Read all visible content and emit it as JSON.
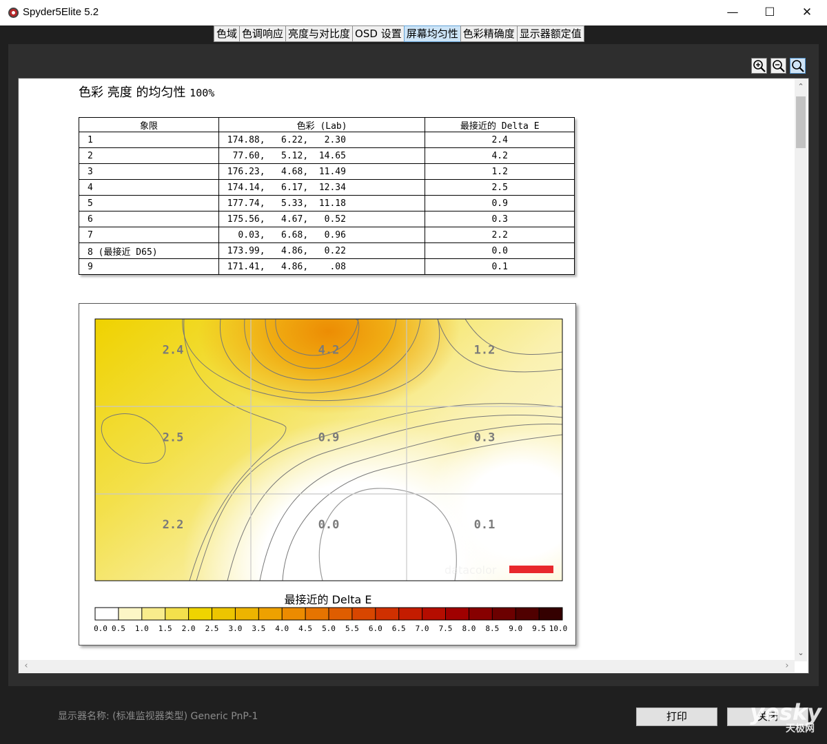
{
  "window": {
    "title": "Spyder5Elite 5.2",
    "minimize": "—",
    "maximize": "☐",
    "close": "✕"
  },
  "tabs": [
    {
      "label": "色域",
      "active": false
    },
    {
      "label": "色调响应",
      "active": false
    },
    {
      "label": "亮度与对比度",
      "active": false
    },
    {
      "label": "OSD 设置",
      "active": false
    },
    {
      "label": "屏幕均匀性",
      "active": true
    },
    {
      "label": "色彩精确度",
      "active": false
    },
    {
      "label": "显示器额定值",
      "active": false
    }
  ],
  "zoom_tools": [
    "zoom-in-icon",
    "zoom-out-icon",
    "zoom-fit-icon"
  ],
  "report": {
    "title": "色彩 亮度 的均匀性 ",
    "title_pct": "100%",
    "table": {
      "headers": [
        "象限",
        "色彩 (Lab)",
        "最接近的 Delta E"
      ],
      "rows": [
        {
          "q": "1",
          "lab": "174.88,   6.22,   2.30",
          "de": "2.4"
        },
        {
          "q": "2",
          "lab": " 77.60,   5.12,  14.65",
          "de": "4.2"
        },
        {
          "q": "3",
          "lab": "176.23,   4.68,  11.49",
          "de": "1.2"
        },
        {
          "q": "4",
          "lab": "174.14,   6.17,  12.34",
          "de": "2.5"
        },
        {
          "q": "5",
          "lab": "177.74,   5.33,  11.18",
          "de": "0.9"
        },
        {
          "q": "6",
          "lab": "175.56,   4.67,   0.52",
          "de": "0.3"
        },
        {
          "q": "7",
          "lab": "  0.03,   6.68,   0.96",
          "de": "2.2"
        },
        {
          "q": "8 (最接近 D65)",
          "lab": "173.99,   4.86,   0.22",
          "de": "0.0"
        },
        {
          "q": "9",
          "lab": "171.41,   4.86,    .08",
          "de": "0.1"
        }
      ]
    }
  },
  "chart_data": {
    "type": "heatmap",
    "grid": {
      "rows": 3,
      "cols": 3
    },
    "cells": [
      [
        2.4,
        4.2,
        1.2
      ],
      [
        2.5,
        0.9,
        0.3
      ],
      [
        2.2,
        0.0,
        0.1
      ]
    ],
    "cell_labels": [
      [
        "2.4",
        "4.2",
        "1.2"
      ],
      [
        "2.5",
        "0.9",
        "0.3"
      ],
      [
        "2.2",
        "0.0",
        "0.1"
      ]
    ],
    "legend_title": "最接近的 Delta E",
    "scale_ticks": [
      "0.0",
      "0.5",
      "1.0",
      "1.5",
      "2.0",
      "2.5",
      "3.0",
      "3.5",
      "4.0",
      "4.5",
      "5.0",
      "5.5",
      "6.0",
      "6.5",
      "7.0",
      "7.5",
      "8.0",
      "8.5",
      "9.0",
      "9.5",
      "10.0"
    ],
    "scale_range": [
      0,
      10
    ],
    "scale_colors": [
      "#ffffff",
      "#fcf6c6",
      "#f8ec8c",
      "#f3e04c",
      "#efd400",
      "#edc500",
      "#edb400",
      "#eea100",
      "#ec8b00",
      "#e67400",
      "#df5d00",
      "#d84600",
      "#cf3000",
      "#c41c00",
      "#b50d00",
      "#a00000",
      "#870000",
      "#6c0000",
      "#500000",
      "#340000"
    ],
    "watermark": "datacolor",
    "colors": {
      "accent_red": "#e8282c"
    }
  },
  "footer": {
    "monitor_label": "显示器名称: (标准监视器类型) Generic PnP-1",
    "print_button": "打印",
    "close_button": "关闭"
  },
  "watermark": {
    "line1": "yesky",
    "line2": "天极网"
  }
}
